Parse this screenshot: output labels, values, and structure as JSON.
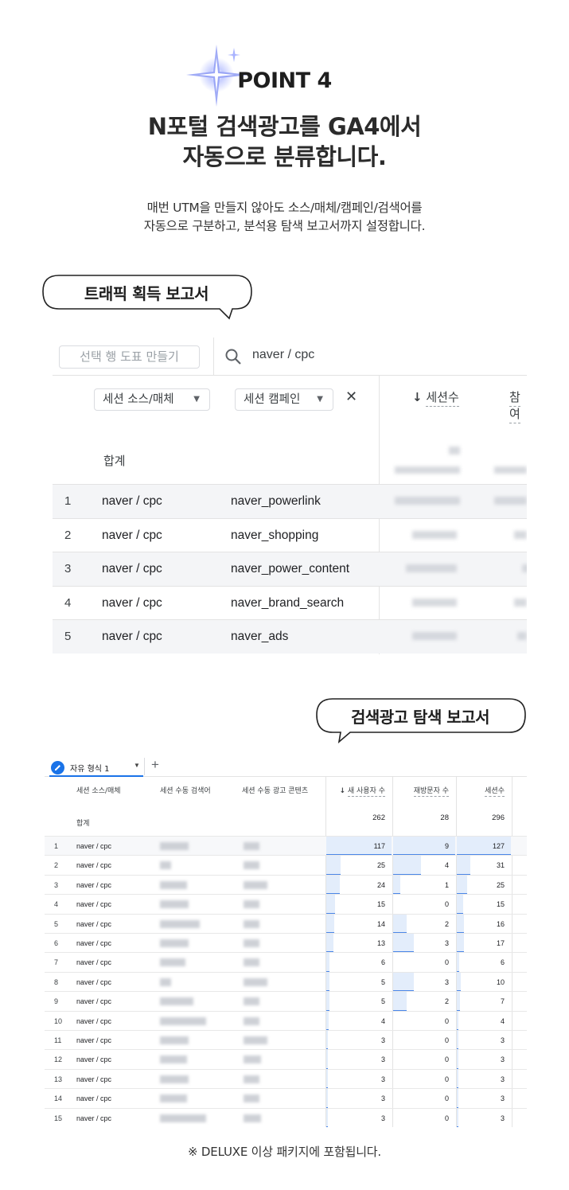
{
  "header": {
    "point_label": "POINT 4",
    "headline_line1": "N포털 검색광고를 GA4에서",
    "headline_line2": "자동으로 분류합니다.",
    "sub_line1": "매번 UTM을 만들지 않아도 소스/매체/캠페인/검색어를",
    "sub_line2": "자동으로 구분하고, 분석용 탐색 보고서까지 설정합니다."
  },
  "bubble1": {
    "label": "트래픽 획득 보고서"
  },
  "bubble2": {
    "label": "검색광고 탐색 보고서"
  },
  "report1": {
    "create_comparison_button": "선택 행 도표 만들기",
    "search_value": "naver / cpc",
    "dim1_dropdown": "세션 소스/매체",
    "dim2_dropdown": "세션 캠페인",
    "metric1_header": "세션수",
    "metric2_header": "참여",
    "total_label": "합계",
    "rows": [
      {
        "idx": "1",
        "source": "naver / cpc",
        "campaign": "naver_powerlink"
      },
      {
        "idx": "2",
        "source": "naver / cpc",
        "campaign": "naver_shopping"
      },
      {
        "idx": "3",
        "source": "naver / cpc",
        "campaign": "naver_power_content"
      },
      {
        "idx": "4",
        "source": "naver / cpc",
        "campaign": "naver_brand_search"
      },
      {
        "idx": "5",
        "source": "naver / cpc",
        "campaign": "naver_ads"
      }
    ]
  },
  "report2": {
    "tab_label": "자유 형식 1",
    "headers": {
      "source": "세션 소스/매체",
      "keyword": "세션 수동 검색어",
      "content": "세션 수동 광고 콘텐츠",
      "new_users": "새 사용자 수",
      "returning": "재방문자 수",
      "sessions": "세션수"
    },
    "total_label": "합계",
    "totals": {
      "new_users": "262",
      "returning": "28",
      "sessions": "296"
    },
    "rows": [
      {
        "idx": "1",
        "source": "naver / cpc",
        "new_users": "117",
        "returning": "9",
        "sessions": "127"
      },
      {
        "idx": "2",
        "source": "naver / cpc",
        "new_users": "25",
        "returning": "4",
        "sessions": "31"
      },
      {
        "idx": "3",
        "source": "naver / cpc",
        "new_users": "24",
        "returning": "1",
        "sessions": "25"
      },
      {
        "idx": "4",
        "source": "naver / cpc",
        "new_users": "15",
        "returning": "0",
        "sessions": "15"
      },
      {
        "idx": "5",
        "source": "naver / cpc",
        "new_users": "14",
        "returning": "2",
        "sessions": "16"
      },
      {
        "idx": "6",
        "source": "naver / cpc",
        "new_users": "13",
        "returning": "3",
        "sessions": "17"
      },
      {
        "idx": "7",
        "source": "naver / cpc",
        "new_users": "6",
        "returning": "0",
        "sessions": "6"
      },
      {
        "idx": "8",
        "source": "naver / cpc",
        "new_users": "5",
        "returning": "3",
        "sessions": "10"
      },
      {
        "idx": "9",
        "source": "naver / cpc",
        "new_users": "5",
        "returning": "2",
        "sessions": "7"
      },
      {
        "idx": "10",
        "source": "naver / cpc",
        "new_users": "4",
        "returning": "0",
        "sessions": "4"
      },
      {
        "idx": "11",
        "source": "naver / cpc",
        "new_users": "3",
        "returning": "0",
        "sessions": "3"
      },
      {
        "idx": "12",
        "source": "naver / cpc",
        "new_users": "3",
        "returning": "0",
        "sessions": "3"
      },
      {
        "idx": "13",
        "source": "naver / cpc",
        "new_users": "3",
        "returning": "0",
        "sessions": "3"
      },
      {
        "idx": "14",
        "source": "naver / cpc",
        "new_users": "3",
        "returning": "0",
        "sessions": "3"
      },
      {
        "idx": "15",
        "source": "naver / cpc",
        "new_users": "3",
        "returning": "0",
        "sessions": "3"
      }
    ]
  },
  "footnote": "※ DELUXE 이상 패키지에 포함됩니다.",
  "colors": {
    "accent": "#1a73e8",
    "bar_fill": "#e3edfb",
    "bar_line": "#4a86e8",
    "sparkle": "#8f9cf5"
  },
  "icons": [
    "sparkle-icon",
    "search-icon",
    "close-icon",
    "sort-down-icon",
    "pencil-icon",
    "plus-icon",
    "chevron-down-icon"
  ]
}
